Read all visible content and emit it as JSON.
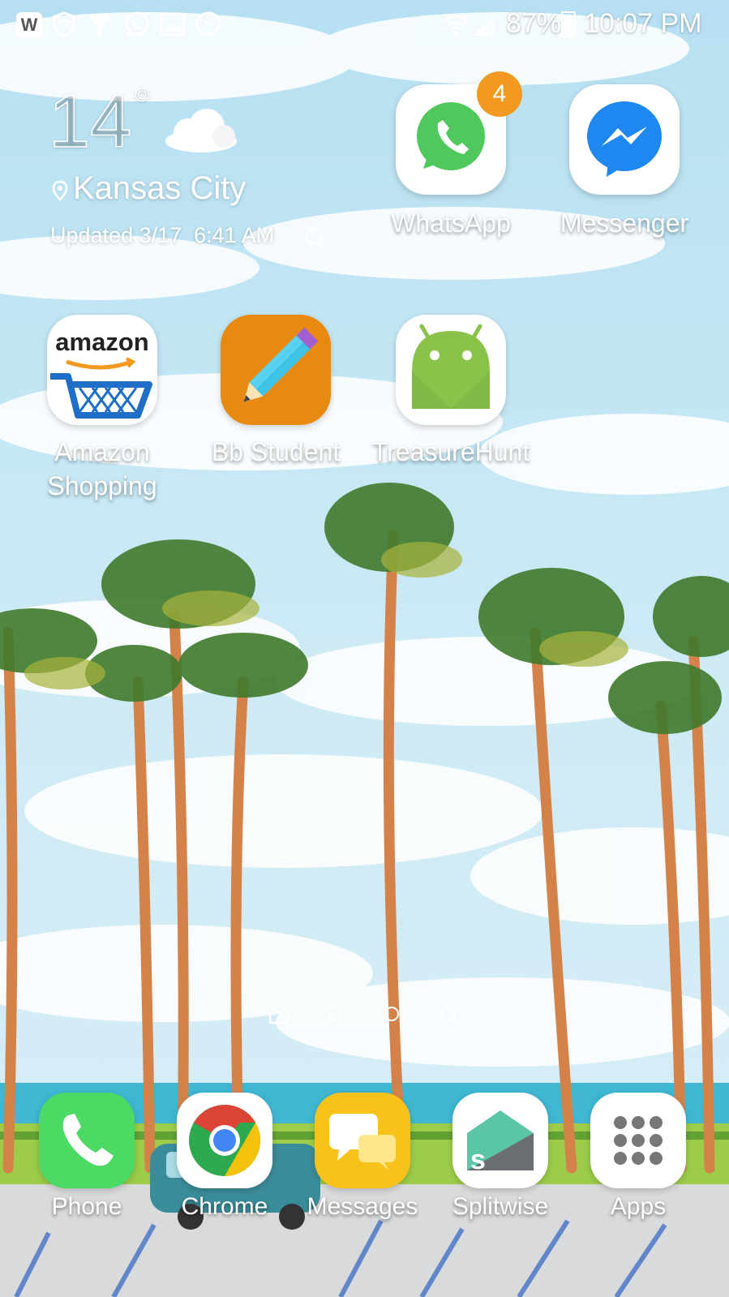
{
  "status_bar": {
    "notification_icons": [
      "w-app-icon",
      "vpn-shield-icon",
      "usb-debug-icon",
      "whatsapp-icon",
      "gallery-image-icon",
      "messenger-icon"
    ],
    "battery_percent": "87%",
    "battery_level": 0.87,
    "time": "10:07 PM"
  },
  "weather": {
    "temperature": "14",
    "degree_symbol": "°",
    "city": "Kansas City",
    "updated": "Updated 3/17  6:41 AM"
  },
  "apps": {
    "whatsapp": {
      "label": "WhatsApp",
      "badge": "4"
    },
    "messenger": {
      "label": "Messenger"
    },
    "amazon": {
      "label_line1": "Amazon",
      "label_line2": "Shopping",
      "logo_text": "amazon"
    },
    "bb_student": {
      "label": "Bb Student"
    },
    "treasure_hunt": {
      "label": "TreasureHunt"
    }
  },
  "page_indicator": {
    "pages": 4,
    "current": "home"
  },
  "dock": {
    "phone": "Phone",
    "chrome": "Chrome",
    "messages": "Messages",
    "splitwise": "Splitwise",
    "apps": "Apps"
  },
  "colors": {
    "whatsapp_green": "#4fc95e",
    "messenger_blue": "#1e88f0",
    "badge_orange": "#f29a1f",
    "bb_orange": "#e98a10",
    "android_green": "#8bc34a",
    "phone_green": "#4cd964",
    "messages_yellow": "#f8c21a",
    "splitwise_teal": "#5bc5a7",
    "sky_blue": "#bfe4f3"
  }
}
